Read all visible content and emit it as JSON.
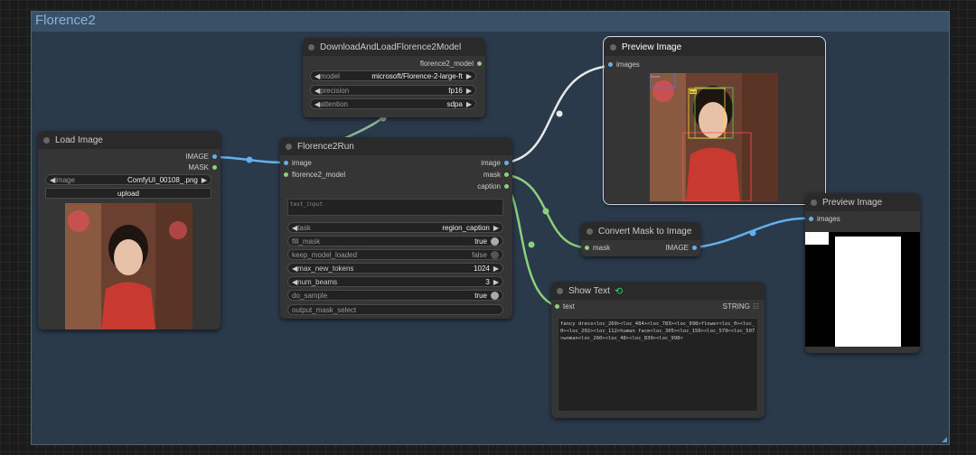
{
  "group": {
    "title": "Florence2"
  },
  "download_node": {
    "title": "DownloadAndLoadFlorence2Model",
    "output": "florence2_model",
    "widgets": [
      {
        "label": "model",
        "value": "microsoft/Florence-2-large-ft"
      },
      {
        "label": "precision",
        "value": "fp16"
      },
      {
        "label": "attention",
        "value": "sdpa"
      }
    ]
  },
  "load_image": {
    "title": "Load Image",
    "outputs": [
      "IMAGE",
      "MASK"
    ],
    "image_label": "image",
    "image_value": "ComfyUI_00108_.png",
    "upload_label": "upload"
  },
  "florence_run": {
    "title": "Florence2Run",
    "inputs": [
      "image",
      "florence2_model"
    ],
    "outputs": [
      "image",
      "mask",
      "caption"
    ],
    "text_input_placeholder": "text_input",
    "task": {
      "label": "task",
      "value": "region_caption"
    },
    "fill_mask": {
      "label": "fill_mask",
      "value": "true"
    },
    "keep_model_loaded": {
      "label": "keep_model_loaded",
      "value": "false"
    },
    "max_new_tokens": {
      "label": "max_new_tokens",
      "value": "1024"
    },
    "num_beams": {
      "label": "num_beams",
      "value": "3"
    },
    "do_sample": {
      "label": "do_sample",
      "value": "true"
    },
    "output_mask_select": {
      "label": "output_mask_select"
    }
  },
  "preview1": {
    "title": "Preview Image",
    "input": "images",
    "box1": "flower",
    "box2": "face"
  },
  "convert_mask": {
    "title": "Convert Mask to Image",
    "input": "mask",
    "output": "IMAGE"
  },
  "preview2": {
    "title": "Preview Image",
    "input": "images"
  },
  "show_text": {
    "title": "Show Text",
    "input": "text",
    "output": "STRING",
    "content": "fancy dress<loc_260><loc_484><loc_783><loc_998>flower<loc_0><loc_0><loc_202><loc_112>human face<loc_305><loc_156><loc_579><loc_507>woman<loc_260><loc_48><loc_839><loc_998>"
  },
  "colors": {
    "image_link": "#62b0ee",
    "mask_link": "#8bd17b",
    "string_link": "#8bd17b",
    "model_link": "#8fb59a"
  }
}
